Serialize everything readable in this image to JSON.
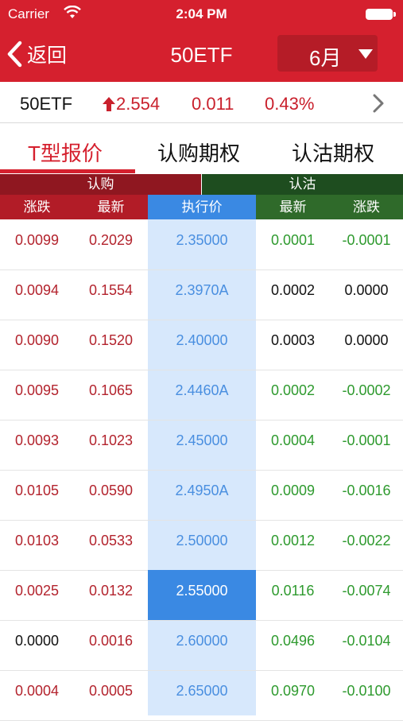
{
  "status_bar": {
    "carrier": "Carrier",
    "time": "2:04 PM"
  },
  "nav": {
    "back_label": "返回",
    "title": "50ETF",
    "month": "6月"
  },
  "quote": {
    "name": "50ETF",
    "price": "2.554",
    "change": "0.011",
    "change_pct": "0.43%",
    "direction": "up"
  },
  "tabs": [
    {
      "label": "T型报价",
      "active": true
    },
    {
      "label": "认购期权",
      "active": false
    },
    {
      "label": "认沽期权",
      "active": false
    }
  ],
  "sections": {
    "call": "认购",
    "put": "认沽"
  },
  "columns": [
    "涨跌",
    "最新",
    "执行价",
    "最新",
    "涨跌"
  ],
  "colors": {
    "brand_red": "#d5202e",
    "rise": "#b3232d",
    "fall": "#2e9a2e",
    "strike_blue": "#4a8fe0"
  },
  "rows": [
    {
      "call_change": "0.0099",
      "call_last": "0.2029",
      "strike": "2.35000",
      "put_last": "0.0001",
      "put_change": "-0.0001"
    },
    {
      "call_change": "0.0094",
      "call_last": "0.1554",
      "strike": "2.3970A",
      "put_last": "0.0002",
      "put_change": "0.0000"
    },
    {
      "call_change": "0.0090",
      "call_last": "0.1520",
      "strike": "2.40000",
      "put_last": "0.0003",
      "put_change": "0.0000"
    },
    {
      "call_change": "0.0095",
      "call_last": "0.1065",
      "strike": "2.4460A",
      "put_last": "0.0002",
      "put_change": "-0.0002"
    },
    {
      "call_change": "0.0093",
      "call_last": "0.1023",
      "strike": "2.45000",
      "put_last": "0.0004",
      "put_change": "-0.0001"
    },
    {
      "call_change": "0.0105",
      "call_last": "0.0590",
      "strike": "2.4950A",
      "put_last": "0.0009",
      "put_change": "-0.0016"
    },
    {
      "call_change": "0.0103",
      "call_last": "0.0533",
      "strike": "2.50000",
      "put_last": "0.0012",
      "put_change": "-0.0022"
    },
    {
      "call_change": "0.0025",
      "call_last": "0.0132",
      "strike": "2.55000",
      "put_last": "0.0116",
      "put_change": "-0.0074"
    },
    {
      "call_change": "0.0000",
      "call_last": "0.0016",
      "strike": "2.60000",
      "put_last": "0.0496",
      "put_change": "-0.0104"
    },
    {
      "call_change": "0.0004",
      "call_last": "0.0005",
      "strike": "2.65000",
      "put_last": "0.0970",
      "put_change": "-0.0100"
    }
  ]
}
